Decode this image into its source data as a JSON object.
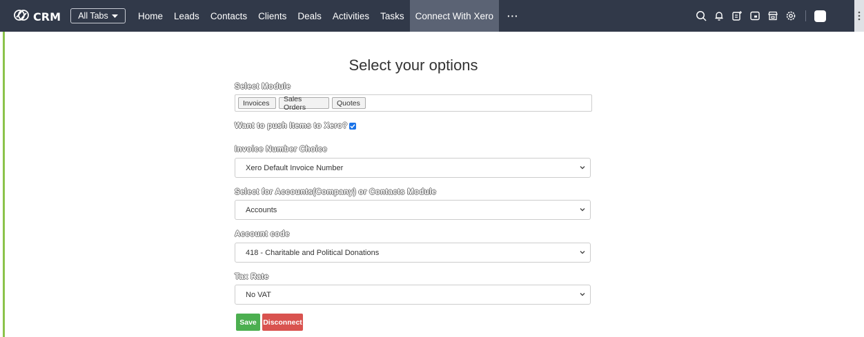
{
  "app": {
    "name": "CRM"
  },
  "topbar": {
    "all_tabs_label": "All Tabs",
    "tabs": [
      {
        "label": "Home"
      },
      {
        "label": "Leads"
      },
      {
        "label": "Contacts"
      },
      {
        "label": "Clients"
      },
      {
        "label": "Deals"
      },
      {
        "label": "Activities"
      },
      {
        "label": "Tasks"
      },
      {
        "label": "Connect With Xero",
        "active": true
      }
    ],
    "more_label": "···",
    "icons": [
      "search-icon",
      "bell-icon",
      "calendar-add-icon",
      "mail-icon",
      "store-icon",
      "gear-icon",
      "avatar"
    ]
  },
  "form": {
    "title": "Select your options",
    "module_label": "Select Module",
    "modules": [
      "Invoices",
      "Sales Orders",
      "Quotes"
    ],
    "push_items_label": "Want to push Items to Xero?",
    "push_items_checked": true,
    "invoice_number_label": "Invoice Number Choice",
    "invoice_number_value": "Xero Default Invoice Number",
    "accounts_module_label": "Select for Accounts(Company) or Contacts Module",
    "accounts_module_value": "Accounts",
    "account_code_label": "Account code",
    "account_code_value": "418 - Charitable and Political Donations",
    "tax_rate_label": "Tax Rate",
    "tax_rate_value": "No VAT",
    "save_label": "Save",
    "disconnect_label": "Disconnect"
  },
  "colors": {
    "topbar": "#313949",
    "active_tab": "#5b6374",
    "accent_green": "#8bc34a",
    "save": "#4caf50",
    "disconnect": "#d9534f"
  }
}
